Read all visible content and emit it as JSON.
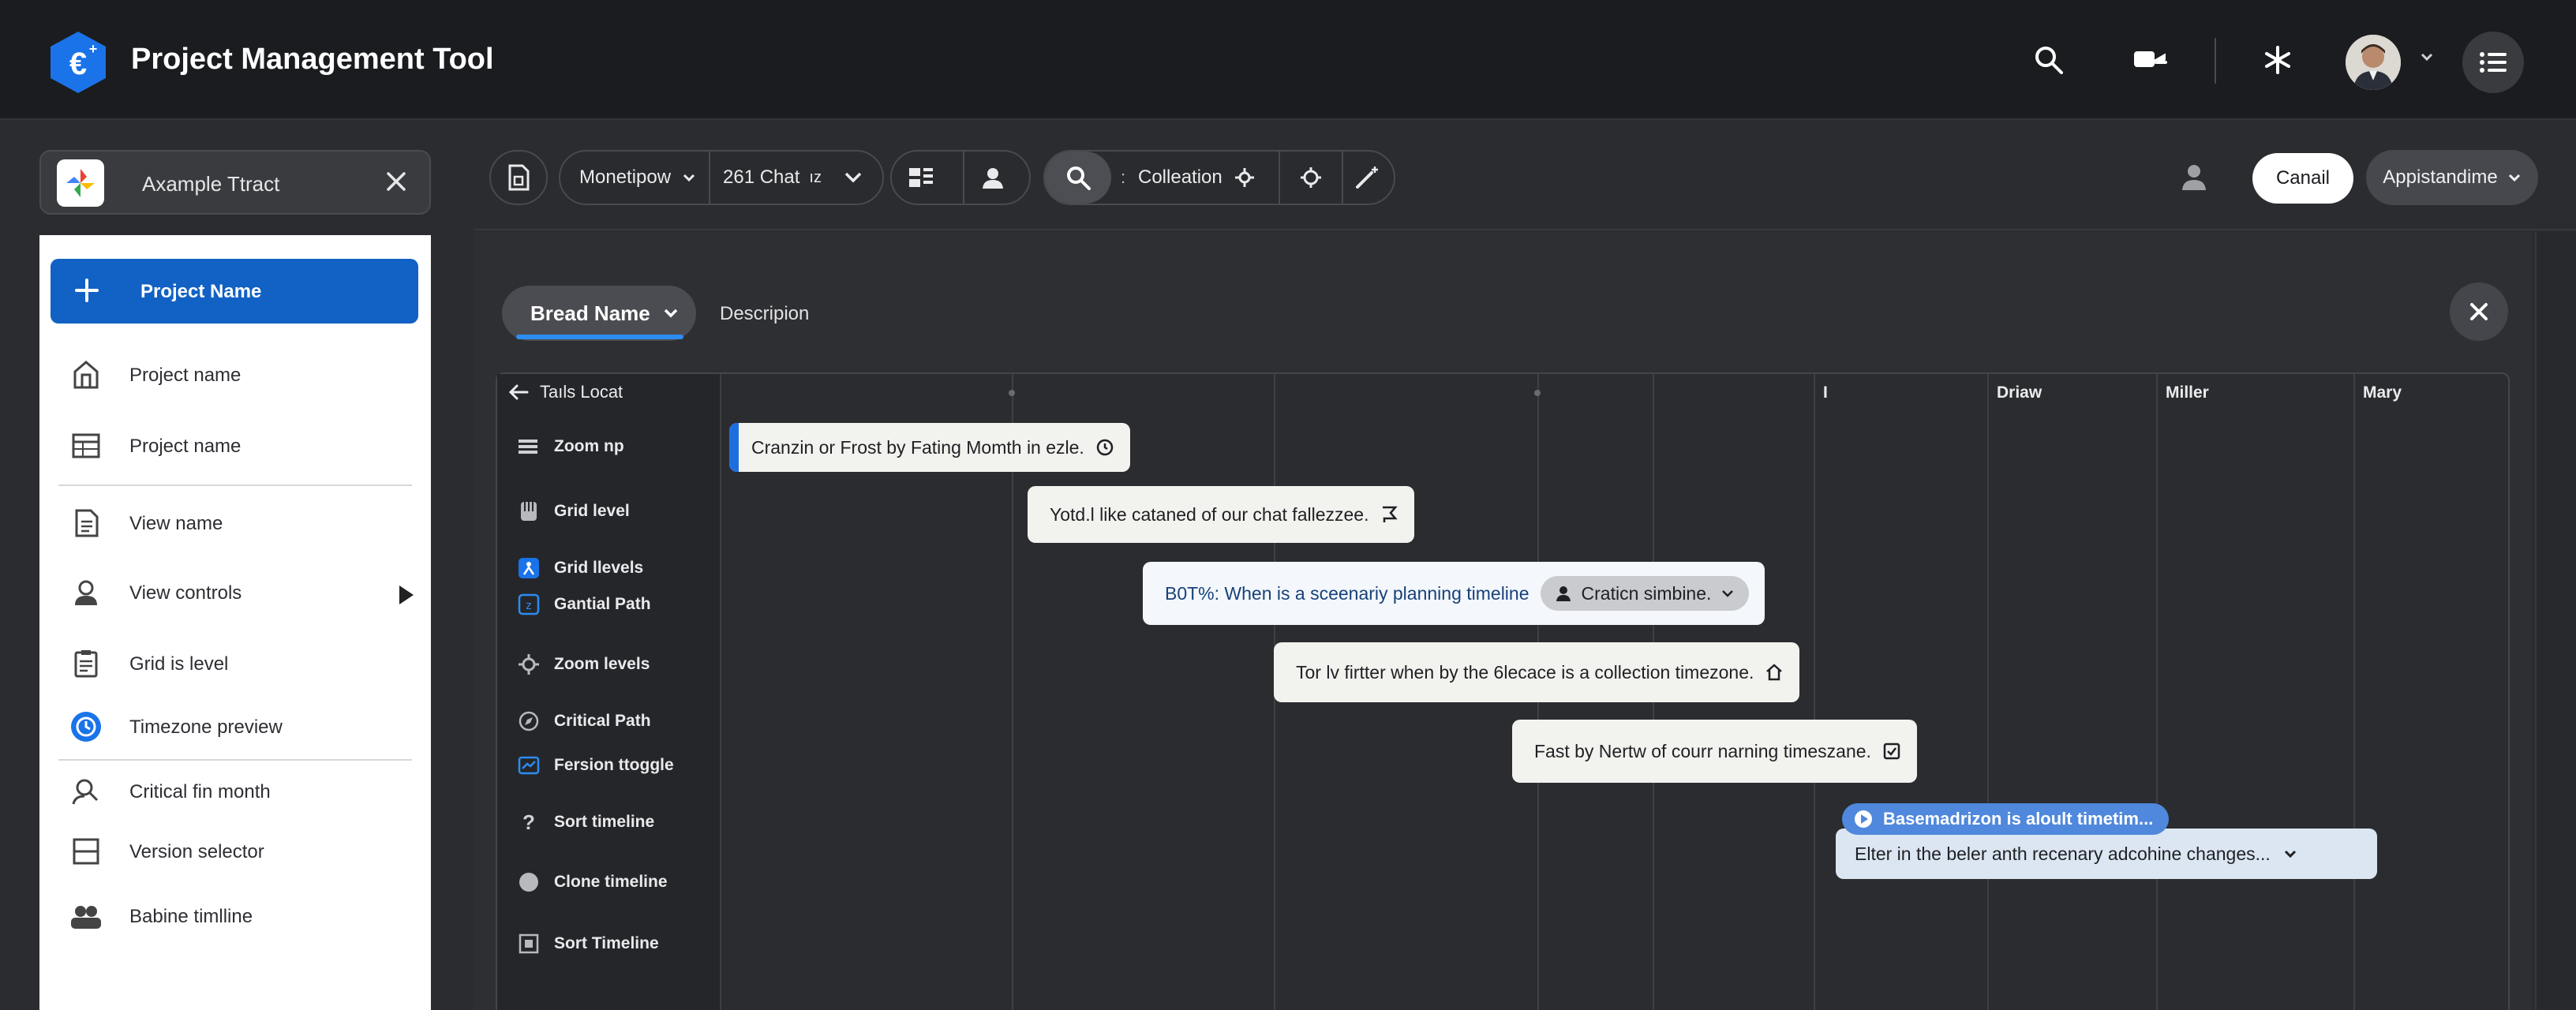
{
  "app": {
    "title": "Project Management Tool",
    "logo_icon": "app-logo-icon",
    "accent": "#1261c4"
  },
  "appbar": {
    "icons": [
      "search-icon",
      "switch-icon",
      "asterisk-icon",
      "avatar",
      "chevron-down-icon",
      "list-menu-icon"
    ]
  },
  "sidebar": {
    "header_title": "Axample Ttract",
    "primary_label": "Project Name",
    "items": [
      {
        "label": "Project name",
        "icon": "building-icon"
      },
      {
        "label": "Project name",
        "icon": "table-icon"
      },
      {
        "label": "View name",
        "icon": "document-icon"
      },
      {
        "label": "View controls",
        "icon": "person-icon"
      },
      {
        "label": "Grid is level",
        "icon": "clipboard-icon"
      },
      {
        "label": "Timezone preview",
        "icon": "timezone-icon"
      },
      {
        "label": "Critical fin month",
        "icon": "user-search-icon"
      },
      {
        "label": "Version selector",
        "icon": "square-minus-icon"
      },
      {
        "label": "Babine timlline",
        "icon": "users-icon"
      }
    ]
  },
  "toolbar": {
    "dropdown1": "Monetipow",
    "dropdown2": "261 Chat",
    "dropdown2_suffix": "ız",
    "search_label": "Colleation",
    "cancel_label": "Canail",
    "apps_label": "Appistandime"
  },
  "tabs": {
    "active": "Bread Name",
    "other": "Descripion"
  },
  "grid": {
    "left_header": "Taıls Locat",
    "left_items": [
      {
        "label": "Zoom np",
        "icon": "lines-icon"
      },
      {
        "label": "Grid level",
        "icon": "layers-icon"
      },
      {
        "label": "Grid llevels",
        "icon": "person-badge-icon"
      },
      {
        "label": "Gantial Path",
        "icon": "number-badge-icon"
      },
      {
        "label": "Zoom levels",
        "icon": "gear-icon"
      },
      {
        "label": "Critical Path",
        "icon": "compass-icon"
      },
      {
        "label": "Fersion ttoggle",
        "icon": "chart-icon"
      },
      {
        "label": "Sort timeline",
        "icon": "question-icon"
      },
      {
        "label": "Clone timeline",
        "icon": "circle-icon"
      },
      {
        "label": "Sort Timeline",
        "icon": "crop-icon"
      }
    ],
    "column_headers": [
      "I",
      "Driaw",
      "Miller",
      "Mary"
    ],
    "tasks": [
      {
        "text": "Cranzin or Frost by Fating Momth in ezle.",
        "icon": "clock-icon"
      },
      {
        "text": "Yotd.l like cataned of our chat fallezzee.",
        "icon": "flag-icon"
      },
      {
        "text": "B0T%:  When is a sceenariy planning timeline",
        "chip": "Craticn simbine.",
        "icon": "person-icon"
      },
      {
        "text": "Tor lv firtter when by the 6lecace is a collection timezone.",
        "icon": "home-icon"
      },
      {
        "text": "Fast by Nertw of courr narning timeszane.",
        "icon": "checkbox-icon"
      }
    ],
    "tooltip": "Basemadrizon is aloult timetim...",
    "blue_task": "Elter  in the beler anth  recenary adcohine changes..."
  }
}
